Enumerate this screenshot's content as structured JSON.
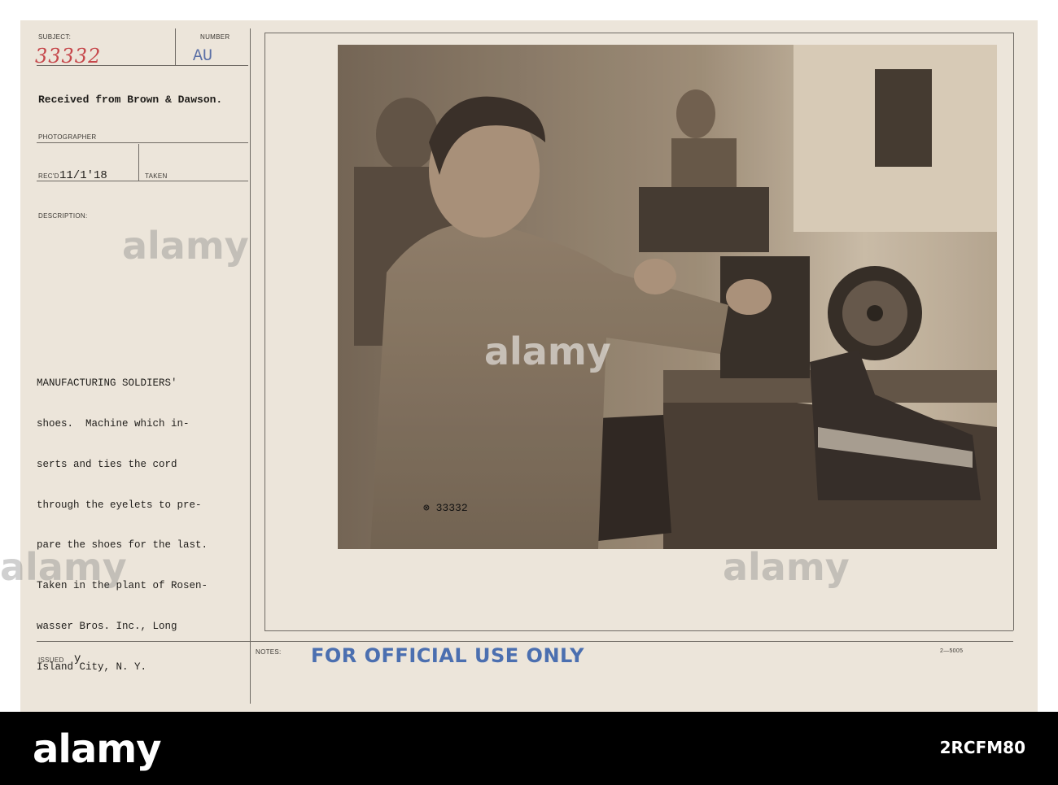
{
  "record": {
    "subject_label": "SUBJECT:",
    "subject_number": "33332",
    "number_label": "NUMBER",
    "number_value": "AU",
    "received_from": "Received from Brown & Dawson.",
    "photographer_label": "PHOTOGRAPHER",
    "recd_label": "REC'D",
    "recd_date": "11/1'18",
    "taken_label": "TAKEN",
    "description_label": "DESCRIPTION:",
    "description": [
      "MANUFACTURING SOLDIERS'",
      "shoes.  Machine which in-",
      "serts and ties the cord",
      "through the eyelets to pre-",
      "pare the shoes for the last.",
      "Taken in the plant of Rosen-",
      "wasser Bros. Inc., Long",
      "Island City, N. Y."
    ],
    "issued_label": "ISSUED",
    "issued_value": "y",
    "notes_label": "NOTES:",
    "stamp": "FOR OFFICIAL USE ONLY",
    "form_number": "2—5005",
    "photo_caption_number": "⊗ 33332"
  },
  "watermarks": {
    "text": "alamy"
  },
  "footer": {
    "logo": "alamy",
    "image_code": "2RCFM80"
  },
  "colors": {
    "card": "#ece5da",
    "handwriting": "#c6474b",
    "stamp": "#4b6fb0",
    "footer": "#000000"
  }
}
